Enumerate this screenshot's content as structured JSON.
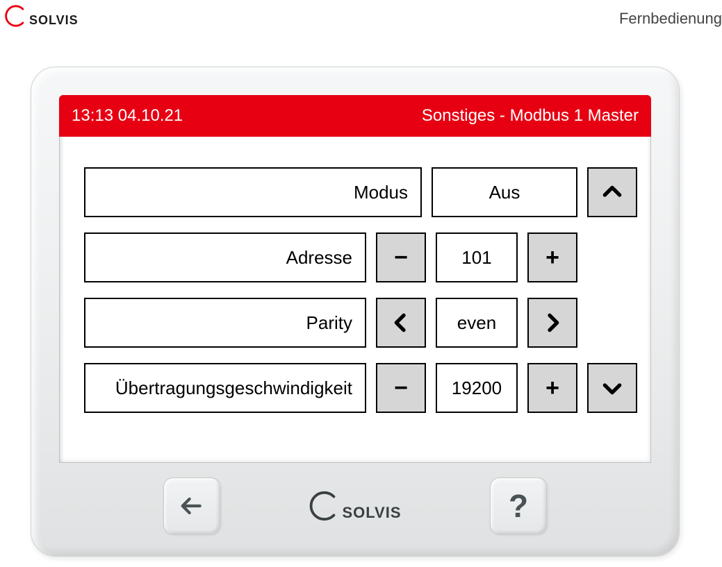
{
  "page": {
    "top_right_label": "Fernbedienung",
    "brand": "SOLVIS"
  },
  "header": {
    "datetime": "13:13 04.10.21",
    "title": "Sonstiges - Modbus 1 Master"
  },
  "rows": {
    "modus": {
      "label": "Modus",
      "value": "Aus"
    },
    "adresse": {
      "label": "Adresse",
      "value": "101"
    },
    "parity": {
      "label": "Parity",
      "value": "even"
    },
    "baud": {
      "label": "Übertragungsgeschwindigkeit",
      "value": "19200"
    }
  },
  "glyphs": {
    "minus": "−",
    "plus": "+",
    "question": "?"
  }
}
